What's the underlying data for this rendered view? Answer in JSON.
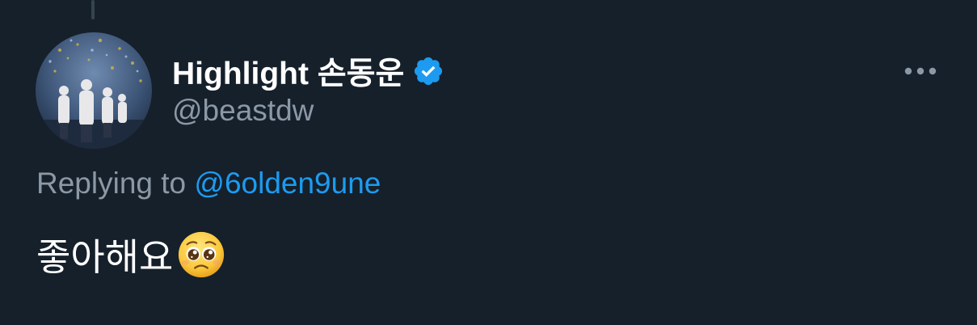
{
  "tweet": {
    "author": {
      "display_name": "Highlight 손동운",
      "handle": "@beastdw",
      "verified": true
    },
    "reply": {
      "prefix": "Replying to",
      "mention": "@6olden9une"
    },
    "text": "좋아해요",
    "emoji": "pleading-face"
  },
  "colors": {
    "background": "#15202b",
    "primary_text": "#ffffff",
    "secondary_text": "#8b98a5",
    "accent": "#1d9bf0",
    "thread_line": "#38444d"
  },
  "icons": {
    "verified": "verified-badge-icon",
    "more": "more-horizontal-icon"
  }
}
